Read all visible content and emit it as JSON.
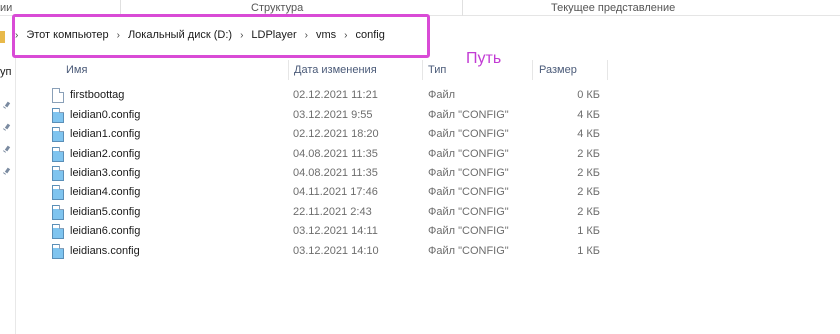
{
  "ribbon": {
    "left_cut": "ии",
    "group_structure": "Структура",
    "group_current_view": "Текущее представление"
  },
  "breadcrumb": {
    "items": [
      "Этот компьютер",
      "Локальный диск (D:)",
      "LDPlayer",
      "vms",
      "config"
    ],
    "separator": "›"
  },
  "annotation": {
    "label": "Путь",
    "color": "#d94bd6"
  },
  "left_pane": {
    "label_cut": "уп"
  },
  "columns": {
    "name": "Имя",
    "date": "Дата изменения",
    "type": "Тип",
    "size": "Размер"
  },
  "files": [
    {
      "name": "firstboottag",
      "date": "02.12.2021 11:21",
      "type": "Файл",
      "size": "0 КБ",
      "icon": "blank-file-icon"
    },
    {
      "name": "leidian0.config",
      "date": "03.12.2021 9:55",
      "type": "Файл \"CONFIG\"",
      "size": "4 КБ",
      "icon": "config-file-icon"
    },
    {
      "name": "leidian1.config",
      "date": "02.12.2021 18:20",
      "type": "Файл \"CONFIG\"",
      "size": "4 КБ",
      "icon": "config-file-icon"
    },
    {
      "name": "leidian2.config",
      "date": "04.08.2021 11:35",
      "type": "Файл \"CONFIG\"",
      "size": "2 КБ",
      "icon": "config-file-icon"
    },
    {
      "name": "leidian3.config",
      "date": "04.08.2021 11:35",
      "type": "Файл \"CONFIG\"",
      "size": "2 КБ",
      "icon": "config-file-icon"
    },
    {
      "name": "leidian4.config",
      "date": "04.11.2021 17:46",
      "type": "Файл \"CONFIG\"",
      "size": "2 КБ",
      "icon": "config-file-icon"
    },
    {
      "name": "leidian5.config",
      "date": "22.11.2021 2:43",
      "type": "Файл \"CONFIG\"",
      "size": "2 КБ",
      "icon": "config-file-icon"
    },
    {
      "name": "leidian6.config",
      "date": "03.12.2021 14:11",
      "type": "Файл \"CONFIG\"",
      "size": "1 КБ",
      "icon": "config-file-icon"
    },
    {
      "name": "leidians.config",
      "date": "03.12.2021 14:10",
      "type": "Файл \"CONFIG\"",
      "size": "1 КБ",
      "icon": "config-file-icon"
    }
  ]
}
